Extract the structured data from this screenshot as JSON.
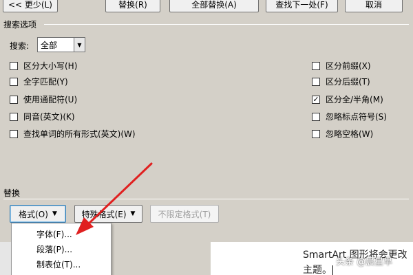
{
  "top_buttons": {
    "less": "<< 更少(L)",
    "replace": "替换(R)",
    "replace_all": "全部替换(A)",
    "find_next": "查找下一处(F)",
    "cancel": "取消"
  },
  "search_options": {
    "title": "搜索选项",
    "search_label": "搜索:",
    "search_value": "全部",
    "left_checks": [
      {
        "label": "区分大小写(H)",
        "checked": false
      },
      {
        "label": "全字匹配(Y)",
        "checked": false
      },
      {
        "label": "使用通配符(U)",
        "checked": false
      },
      {
        "label": "同音(英文)(K)",
        "checked": false
      },
      {
        "label": "查找单词的所有形式(英文)(W)",
        "checked": false
      }
    ],
    "right_checks": [
      {
        "label": "区分前缀(X)",
        "checked": false
      },
      {
        "label": "区分后缀(T)",
        "checked": false
      },
      {
        "label": "区分全/半角(M)",
        "checked": true
      },
      {
        "label": "忽略标点符号(S)",
        "checked": false
      },
      {
        "label": "忽略空格(W)",
        "checked": false
      }
    ]
  },
  "replace_section": {
    "title": "替换",
    "format_button": "格式(O)",
    "special_button": "特殊格式(E)",
    "no_format_button": "不限定格式(T)"
  },
  "format_menu": {
    "items": [
      "字体(F)...",
      "段落(P)...",
      "制表位(T)..."
    ]
  },
  "document": {
    "line1": "SmartArt 图形将会更改",
    "line2": "主题。"
  },
  "watermark": "头条 @晨星早",
  "colors": {
    "dialog_bg": "#d4d0c8",
    "arrow": "#e02020"
  }
}
